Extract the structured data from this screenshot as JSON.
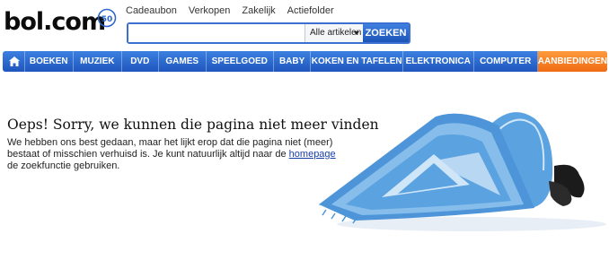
{
  "logo": {
    "text": "bol.com",
    "badge": "50"
  },
  "top_links": [
    "Cadeaubon",
    "Verkopen",
    "Zakelijk",
    "Actiefolder"
  ],
  "search": {
    "value": "",
    "category": "Alle artikelen",
    "button": "ZOEKEN"
  },
  "nav": {
    "home_icon": "home-icon",
    "items": [
      "BOEKEN",
      "MUZIEK",
      "DVD",
      "GAMES",
      "SPEELGOED",
      "BABY",
      "KOKEN EN TAFELEN",
      "ELEKTRONICA",
      "COMPUTER"
    ],
    "deals": "AANBIEDINGEN",
    "colors": {
      "nav_blue": "#2a64cc",
      "deals_orange": "#f07a1f"
    }
  },
  "error": {
    "title": "Oeps! Sorry, we kunnen die pagina niet meer vinden",
    "text_before": "We hebben ons best gedaan, maar het lijkt erop dat die pagina niet (meer) bestaat of misschien verhuisd is. Je kunt natuurlijk altijd naar de",
    "link": "homepage",
    "text_after": "de zoekfunctie gebruiken."
  }
}
